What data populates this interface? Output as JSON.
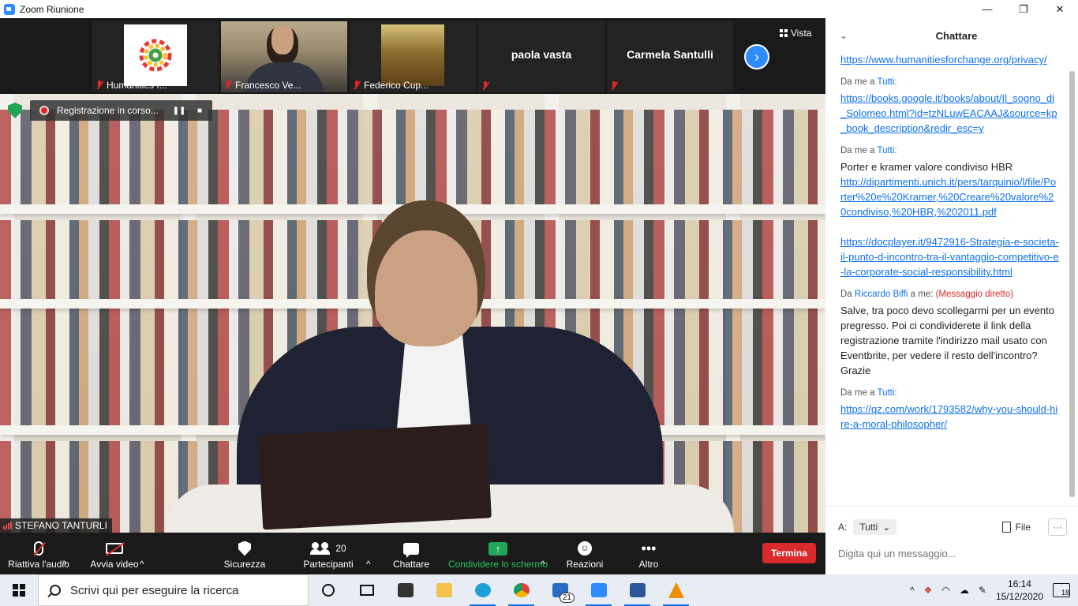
{
  "window": {
    "title": "Zoom Riunione",
    "minimize": "—",
    "maximize": "❐",
    "close": "✕"
  },
  "strip": {
    "participants": [
      {
        "name": "Humanities f..."
      },
      {
        "name": "Francesco Ve..."
      },
      {
        "name": "Federico Cup..."
      },
      {
        "name": "",
        "display": "paola vasta"
      },
      {
        "name": "",
        "display": "Carmela Santulli"
      }
    ],
    "next_arrow": "›",
    "view_label": "Vista"
  },
  "recording": {
    "label": "Registrazione in corso...",
    "pause": "❚❚",
    "stop": "■"
  },
  "speaker": {
    "name": "STEFANO TANTURLI"
  },
  "toolbar": {
    "audio": "Riattiva l'audio",
    "video": "Avvia video",
    "security": "Sicurezza",
    "participants": "Partecipanti",
    "participants_count": "20",
    "chat": "Chattare",
    "share": "Condividere lo schermo",
    "reactions": "Reazioni",
    "more": "Altro",
    "end": "Termina",
    "caret": "^"
  },
  "chat": {
    "title": "Chattare",
    "messages": [
      {
        "link": "https://www.humanitiesforchange.org/privacy/"
      },
      {
        "from": "Da me a",
        "to": "Tutti:",
        "link": "https://books.google.it/books/about/Il_sogno_di_Solomeo.html?id=tzNLuwEACAAJ&source=kp_book_description&redir_esc=y"
      },
      {
        "from": "Da me a",
        "to": "Tutti:",
        "text": "Porter e kramer valore condiviso HBR",
        "link": "http://dipartimenti.unich.it/pers/tarquinio/l/file/Porter%20e%20Kramer,%20Creare%20valore%20condiviso,%20HBR,%202011.pdf",
        "link2": "https://docplayer.it/9472916-Strategia-e-societa-il-punto-d-incontro-tra-il-vantaggio-competitivo-e-la-corporate-social-responsibility.html"
      },
      {
        "from": "Da",
        "sender": "Riccardo Biffi",
        "to_me": "a me:",
        "direct": "(Messaggio diretto)",
        "text": "Salve, tra poco devo scollegarmi per un evento pregresso. Poi ci condividerete il link della registrazione tramite l'indirizzo mail usato con Eventbrite, per vedere il resto dell'incontro? Grazie"
      },
      {
        "from": "Da me a",
        "to": "Tutti:",
        "link": "https://qz.com/work/1793582/why-you-should-hire-a-moral-philosopher/"
      }
    ],
    "to_label": "A:",
    "to_value": "Tutti",
    "file_label": "File",
    "more": "···",
    "input_placeholder": "Digita qui un messaggio..."
  },
  "taskbar": {
    "search_placeholder": "Scrivi qui per eseguire la ricerca",
    "mail_badge": "21",
    "time": "16:14",
    "date": "15/12/2020",
    "notif_count": "18"
  }
}
